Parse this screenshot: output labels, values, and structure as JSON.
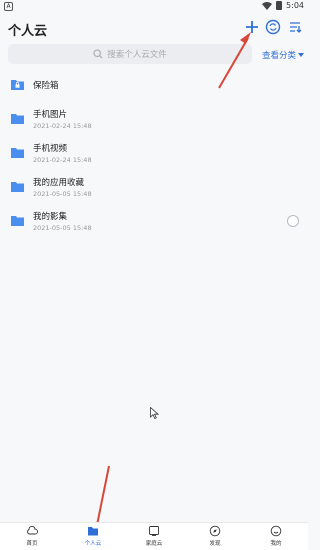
{
  "status_bar": {
    "app_badge": "A",
    "time": "5:04"
  },
  "header": {
    "title": "个人云"
  },
  "search": {
    "placeholder": "搜索个人云文件"
  },
  "category_link": "查看分类",
  "files": [
    {
      "name": "保险箱",
      "date": "",
      "icon": "lock-folder-icon"
    },
    {
      "name": "手机图片",
      "date": "2021-02-24 15:48",
      "icon": "folder-icon"
    },
    {
      "name": "手机视频",
      "date": "2021-02-24 15:48",
      "icon": "folder-icon"
    },
    {
      "name": "我的应用收藏",
      "date": "2021-05-05 15:48",
      "icon": "folder-icon"
    },
    {
      "name": "我的影集",
      "date": "2021-05-05 15:48",
      "icon": "folder-icon"
    }
  ],
  "tabs": [
    {
      "label": "首页",
      "icon": "cloud-icon"
    },
    {
      "label": "个人云",
      "icon": "folder-icon"
    },
    {
      "label": "家庭云",
      "icon": "tv-icon"
    },
    {
      "label": "发现",
      "icon": "compass-icon"
    },
    {
      "label": "我的",
      "icon": "smile-icon"
    }
  ],
  "colors": {
    "accent": "#2f6fd6",
    "folder": "#4a8ef0",
    "annotation_arrow": "#d9463a"
  }
}
